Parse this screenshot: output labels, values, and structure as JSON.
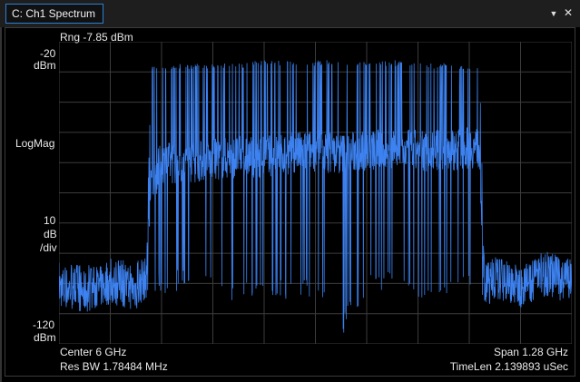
{
  "window": {
    "tab_title": "C: Ch1 Spectrum",
    "menu_icon": "dropdown-arrow-icon",
    "close_icon": "close-icon"
  },
  "display": {
    "range_label": "Rng -7.85 dBm",
    "top_ref_value": "-20",
    "top_ref_unit": "dBm",
    "format_label": "LogMag",
    "scale_value": "10",
    "scale_unit": "dB",
    "scale_per": "/div",
    "bottom_ref_value": "-120",
    "bottom_ref_unit": "dBm",
    "center_label": "Center 6 GHz",
    "span_label": "Span 1.28 GHz",
    "resbw_label": "Res BW 1.78484 MHz",
    "timelen_label": "TimeLen 2.139893 uSec"
  },
  "colors": {
    "trace": "#3d82f0",
    "grid": "#3c3c3c",
    "accent": "#2d7fd6",
    "background": "#000000"
  },
  "chart_data": {
    "type": "line",
    "center_ghz": 6,
    "span_ghz": 1.28,
    "ylim": [
      -120,
      -20
    ],
    "y_unit": "dBm",
    "grid": true,
    "divisions_x": 10,
    "divisions_y": 10,
    "series": [
      {
        "x": [
          5.36,
          5.424,
          5.488,
          5.552,
          5.5776,
          5.5905,
          5.616,
          5.68,
          5.744,
          5.808,
          5.872,
          5.936,
          6.0,
          6.064,
          6.128,
          6.192,
          6.256,
          6.32,
          6.384,
          6.4095,
          6.4224,
          6.448,
          6.512,
          6.576,
          6.64
        ],
        "y": [
          -101,
          -103,
          -100,
          -102,
          -98,
          -67,
          -60,
          -60,
          -59,
          -58,
          -58,
          -57,
          -56,
          -57,
          -56,
          -56,
          -56,
          -56,
          -55,
          -55,
          -102,
          -98,
          -101,
          -97,
          -100
        ],
        "y_peak": [
          -94,
          -95,
          -92,
          -94,
          -90,
          -29,
          -29,
          -28,
          -28,
          -28,
          -27,
          -27,
          -27,
          -27,
          -27,
          -27,
          -28,
          -28,
          -28,
          -29,
          -94,
          -92,
          -95,
          -90,
          -93
        ],
        "y_floor": [
          -108,
          -110,
          -107,
          -109,
          -105,
          -102,
          -104,
          -103,
          -105,
          -110,
          -102,
          -108,
          -104,
          -118,
          -104,
          -103,
          -110,
          -104,
          -103,
          -101,
          -108,
          -106,
          -109,
          -104,
          -110
        ]
      }
    ]
  }
}
